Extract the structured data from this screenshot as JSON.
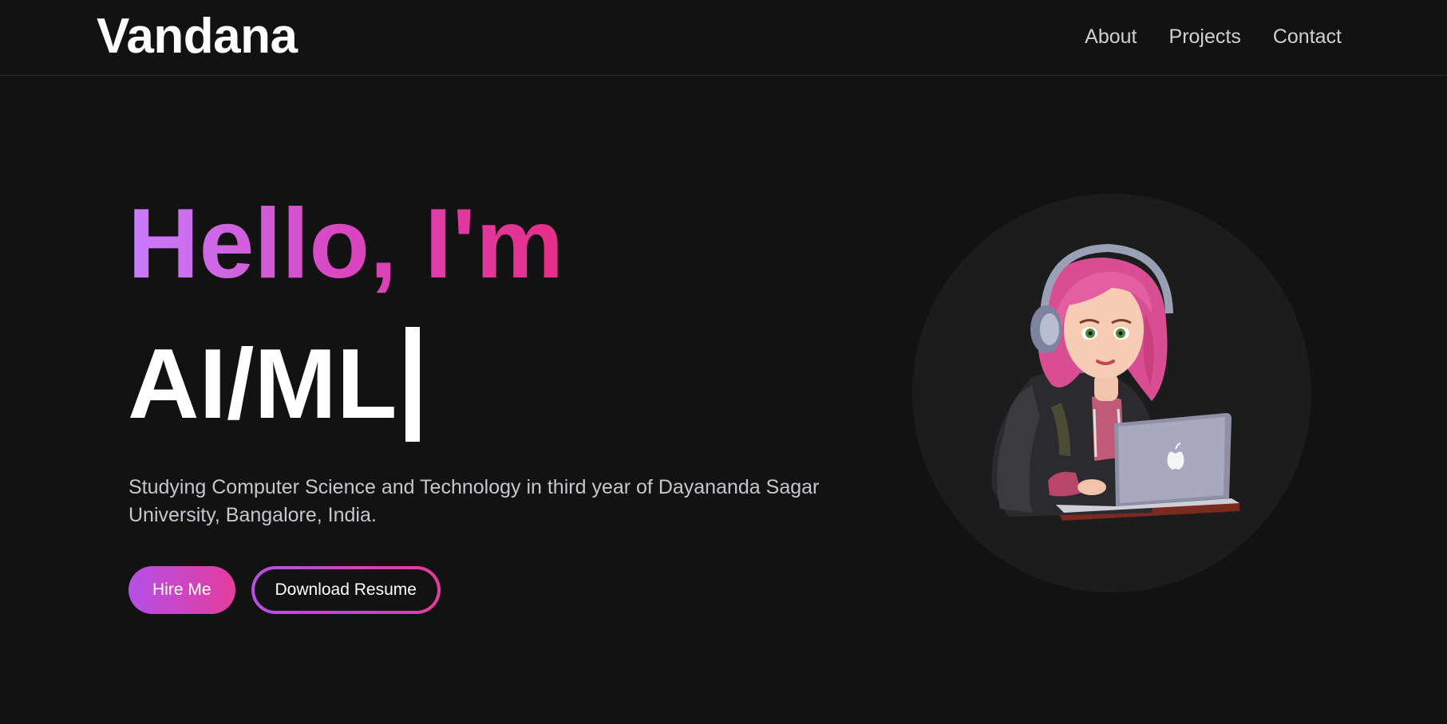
{
  "header": {
    "brand": "Vandana",
    "nav": [
      "About",
      "Projects",
      "Contact"
    ]
  },
  "hero": {
    "greeting": "Hello, I'm",
    "role": "AI/ML",
    "description": "Studying Computer Science and Technology in third year of Dayananda Sagar University, Bangalore, India.",
    "primary_button": "Hire Me",
    "secondary_button": "Download Resume"
  },
  "colors": {
    "background": "#121212",
    "gradient_start": "#c77dff",
    "gradient_end": "#e62e86",
    "nav_text": "#d0d0d0",
    "body_text": "#c6c6cc"
  },
  "icons": {
    "avatar": "girl-with-headphones-laptop-avatar"
  }
}
